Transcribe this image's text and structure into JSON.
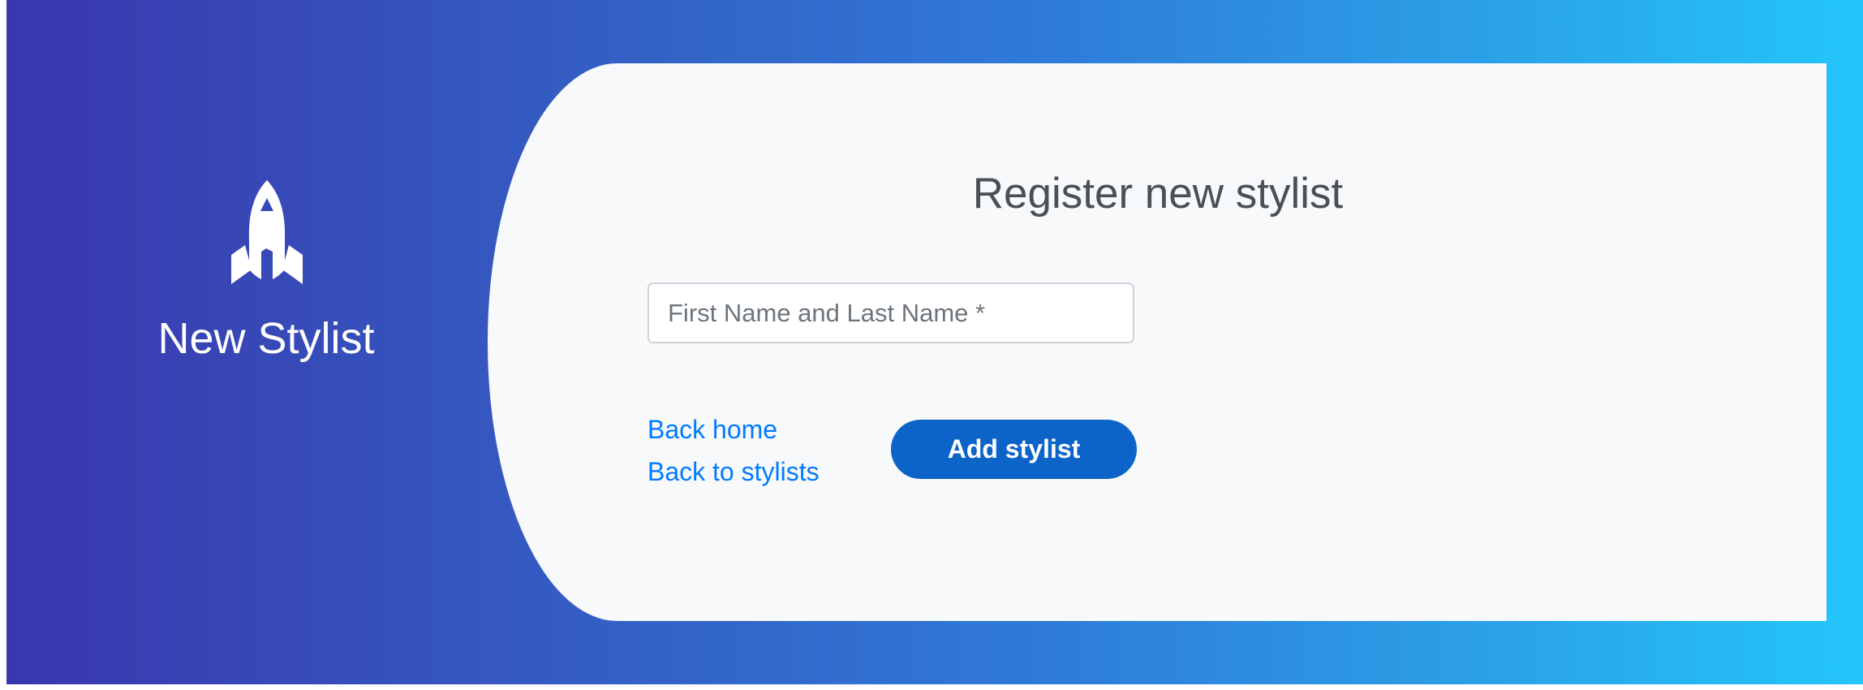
{
  "sidebar": {
    "icon": "rocket-icon",
    "title": "New Stylist"
  },
  "form": {
    "heading": "Register new stylist",
    "name_placeholder": "First Name and Last Name *",
    "name_value": "",
    "submit_label": "Add stylist"
  },
  "links": {
    "back_home": "Back home",
    "back_to_stylists": "Back to stylists"
  },
  "colors": {
    "gradient_start": "#3a37ae",
    "gradient_end": "#23c6fb",
    "card_background": "#f8f9fa",
    "heading_text": "#495057",
    "link": "#007bff",
    "button": "#0d64c8"
  }
}
